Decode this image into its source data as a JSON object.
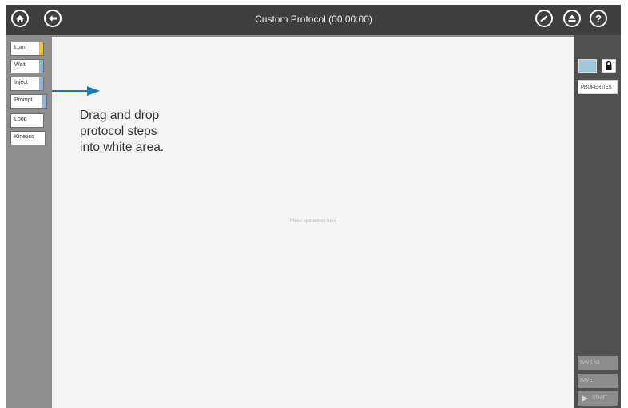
{
  "window": {
    "title": "Custom Protocol (00:00:00)"
  },
  "topbar": {
    "home_icon": "home-icon",
    "back_icon": "back-arrow-icon",
    "gauge_icon": "gauge-icon",
    "eject_icon": "eject-icon",
    "help_icon": "help-icon",
    "help_glyph": "?"
  },
  "steps": [
    {
      "label": "Lumi",
      "color": "#f5c518"
    },
    {
      "label": "Wait",
      "color": "#8fb4e0"
    },
    {
      "label": "Inject",
      "color": "#8fb4e0"
    },
    {
      "label": "Prompt",
      "color": "#8fb4e0"
    },
    {
      "label": "Loop",
      "color": ""
    },
    {
      "label": "Kinetics",
      "color": ""
    }
  ],
  "canvas": {
    "placeholder": "Place operations here"
  },
  "annotation": {
    "line1": "Drag and drop",
    "line2": "protocol steps",
    "line3": "into white area.",
    "arrow_color": "#1a7ab8"
  },
  "right_panel": {
    "color_swatch": "#9ccadb",
    "lock_icon": "lock-icon",
    "properties_label": "PROPERTIES",
    "save_as_label": "SAVE AS",
    "save_label": "SAVE",
    "start_label": "START"
  }
}
